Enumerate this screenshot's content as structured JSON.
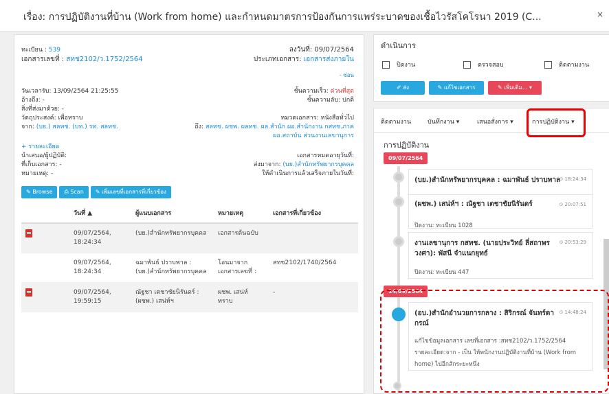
{
  "window": {
    "title": "เรื่อง: การปฏิบัติงานที่บ้าน (Work from home) และกำหนดมาตรการป้องกันการแพร่ระบาดของเชื้อไวรัสโคโรนา 2019 (C...",
    "close": "×"
  },
  "doc": {
    "reg_label": "ทะเบียน :",
    "reg_value": "539",
    "docno_label": "เอกสารเลขที่ :",
    "docno_value": "สทช2102/ว.1752/2564",
    "date_label": "ลงวันที่:",
    "date_value": "09/07/2564",
    "type_label": "ประเภทเอกสาร:",
    "type_value": "เอกสารส่งภายใน",
    "hide": "- ซ่อน",
    "received": "วันเวลารับ: 13/09/2564 21:25:55",
    "ref": "อ้างถึง: -",
    "attach": "สิ่งที่ส่งมาด้วย: -",
    "purpose": "วัตถุประสงค์: เพื่อทราบ",
    "from_label": "จาก:",
    "from_value": "(บย.) สลทช. (บท.) รท. สลทช.",
    "urgency_label": "ชั้นความเร็ว:",
    "urgency_value": "ด่วนที่สุด",
    "secrecy": "ชั้นความลับ: ปกติ",
    "category": "หมวดเอกสาร: หนังสือทั่วไป",
    "to_label": "ถึง:",
    "to_value": "สลทช. ผชพ. ผลทช. ผล.สำนัก ผอ.สำนักงาน กสทช.ภาค",
    "to_value2": "ผอ.สถาบัน ส่วนงานเลขานุการ",
    "details": "+ รายละเอียด",
    "proposer": "นำเสนอ/ผู้ปฏิบัติ:",
    "storage": "ที่เก็บเอกสาร: -",
    "note": "หมายเหตุ: -",
    "expiry": "เอกสารหมดอายุวันที่:",
    "sent_from_label": "ส่งมาจาก:",
    "sent_from_value": "(บย.)สำนักทรัพยากรบุคคล",
    "deadline": "ให้ดำเนินการแล้วเสร็จภายในวันที่:",
    "buttons": {
      "browse": "✎ Browse",
      "scan": "⎙ Scan",
      "related": "✎ เพิ่มเลขที่เอกสารที่เกี่ยวข้อง"
    }
  },
  "table": {
    "headers": [
      "",
      "วันที่ ▲",
      "ผู้แนบเอกสาร",
      "หมายเหตุ",
      "เอกสารที่เกี่ยวข้อง"
    ],
    "rows": [
      {
        "date": "09/07/2564,",
        "time": "18:24:34",
        "by": "(บย.)สำนักทรัพยากรบุคคล",
        "by2": "",
        "note": "เอกสารต้นฉบับ",
        "note2": "",
        "rel": ""
      },
      {
        "date": "09/07/2564,",
        "time": "18:24:34",
        "by": "ฉมาพันธ์ ปราบพาล :",
        "by2": "(บย.)สำนักทรัพยากรบุคคล",
        "note": "โอนมาจาก",
        "note2": "เอกสารเลขที่ :",
        "rel": "สทช2102/1740/2564"
      },
      {
        "date": "09/07/2564,",
        "time": "19:59:15",
        "by": "ณัฐชา เตชาชัยนิรันดร์ :",
        "by2": "(ผชพ.) เสน่ห์ฯ",
        "note": "ผชพ. เสน่ห์",
        "note2": "ทราบ",
        "rel": "-"
      }
    ]
  },
  "actions": {
    "title": "ดำเนินการ",
    "check1": "ปิดงาน",
    "check2": "ตรวจสอบ",
    "check3": "ติดตามงาน",
    "send": "✐ ส่ง",
    "edit": "✎ แก้ไขเอกสาร",
    "more": "✎ เพิ่มเติม... ▾"
  },
  "tabs": {
    "t1": "ติดตามงาน",
    "t2": "บันทึกงาน ▾",
    "t3": "เสนอสั่งการ ▾",
    "t4": "การปฏิบัติงาน ▾"
  },
  "timeline": {
    "heading": "การปฏิบัติงาน",
    "date1": "09/07/2564",
    "e1_title": "(บย.)สำนักทรัพยากรบุคคล : ฉมาพันธ์ ปราบพาล",
    "e1_time": "⊙ 18:24:34",
    "e2_title": "(ผชพ.) เสน่ห์ฯ : ณัฐชา เตชาชัยนิรันดร์",
    "e2_time": "⊙ 20:07:51",
    "e2_sub": "ปิดงาน: ทะเบียน 1028",
    "e3_title": "งานเลขานุการ กสทช. (นายประวิทย์ ลี่สถาพร",
    "e3_title2": "วงศา): พัสนี จำแนกยุทธ์",
    "e3_time": "⊙ 20:53:29",
    "e3_sub": "ปิดงาน: ทะเบียน 447",
    "date2": "14/09/2564",
    "e4_title": "(อบ.)สำนักอำนวยการกลาง : สิริกรณ์ จันทร์ดา",
    "e4_title2": "กรณ์",
    "e4_time": "⊙ 14:48:24",
    "e4_sub1": "แก้ไขข้อมูลเอกสาร เลขที่เอกสาร :สทช2102/ว.1752/2564",
    "e4_sub2": "รายละเอียด:จาก - เป็น ให้พนักงานปฏิบัติงานที่บ้าน (Work from",
    "e4_sub3": "home) ไปอีกสักระยะหนึ่ง"
  },
  "colors": {
    "accent": "#29a8e0",
    "danger": "#e8475a",
    "highlight": "#dd0000"
  }
}
